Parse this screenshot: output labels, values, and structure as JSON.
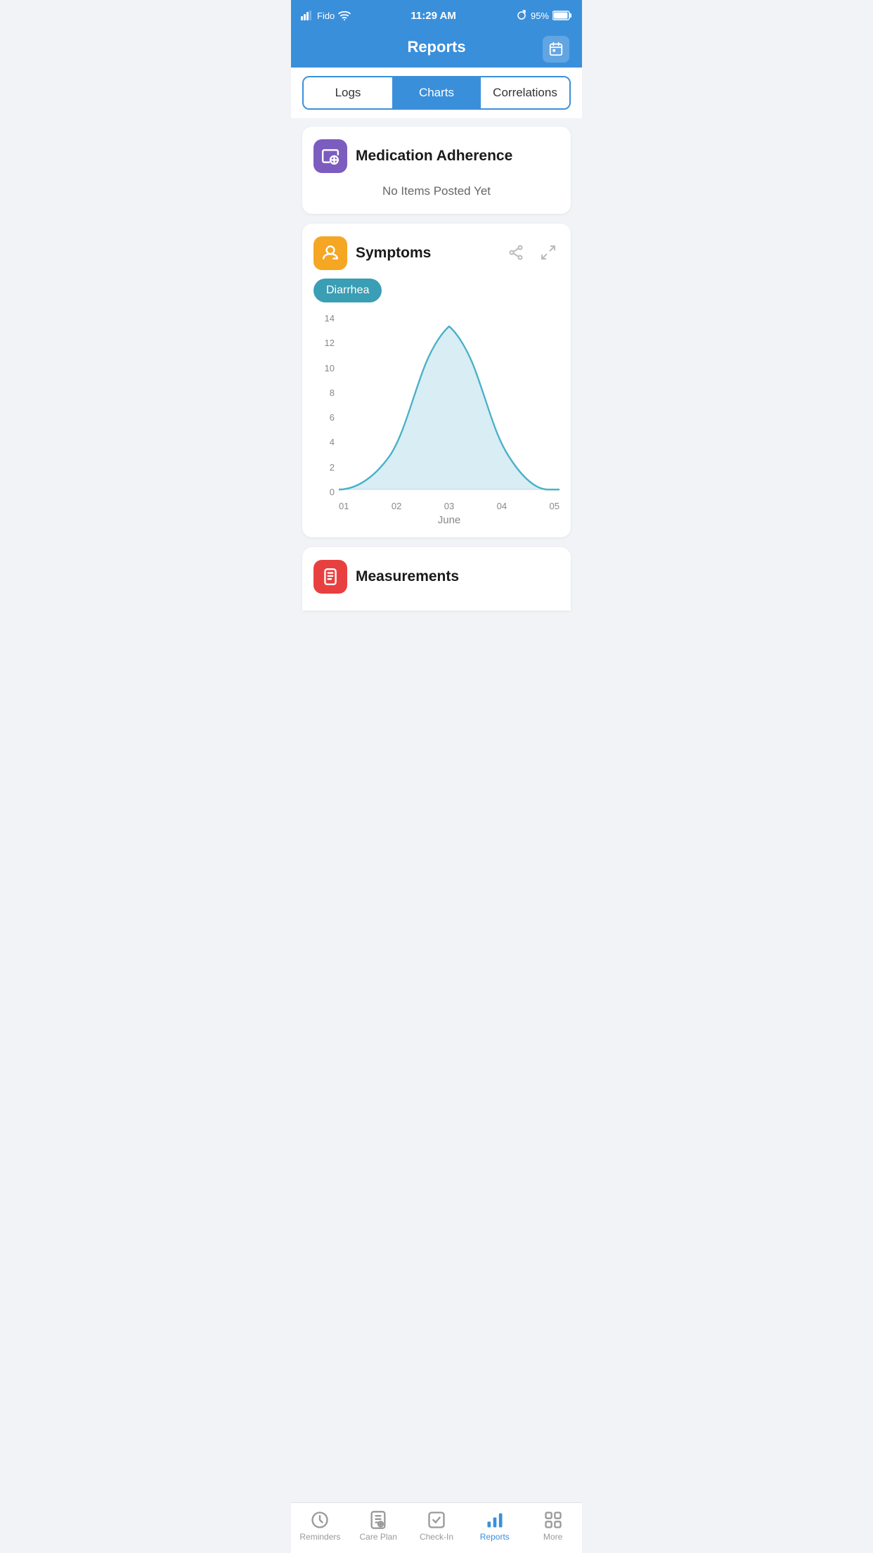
{
  "statusBar": {
    "carrier": "Fido",
    "time": "11:29 AM",
    "battery": "95%"
  },
  "header": {
    "title": "Reports",
    "calendarLabel": "calendar"
  },
  "tabs": {
    "items": [
      {
        "id": "logs",
        "label": "Logs",
        "active": false
      },
      {
        "id": "charts",
        "label": "Charts",
        "active": true
      },
      {
        "id": "correlations",
        "label": "Correlations",
        "active": false
      }
    ]
  },
  "medicationCard": {
    "title": "Medication Adherence",
    "emptyText": "No Items Posted Yet",
    "iconSymbol": "💊"
  },
  "symptomsCard": {
    "title": "Symptoms",
    "tag": "Diarrhea",
    "chartYLabels": [
      "14",
      "12",
      "10",
      "8",
      "6",
      "4",
      "2",
      "0"
    ],
    "chartXLabels": [
      "01",
      "02",
      "03",
      "04",
      "05"
    ],
    "monthLabel": "June"
  },
  "measurementsCard": {
    "title": "Measurements"
  },
  "bottomNav": {
    "items": [
      {
        "id": "reminders",
        "label": "Reminders",
        "active": false
      },
      {
        "id": "care-plan",
        "label": "Care Plan",
        "active": false
      },
      {
        "id": "check-in",
        "label": "Check-In",
        "active": false
      },
      {
        "id": "reports",
        "label": "Reports",
        "active": true
      },
      {
        "id": "more",
        "label": "More",
        "active": false
      }
    ]
  }
}
